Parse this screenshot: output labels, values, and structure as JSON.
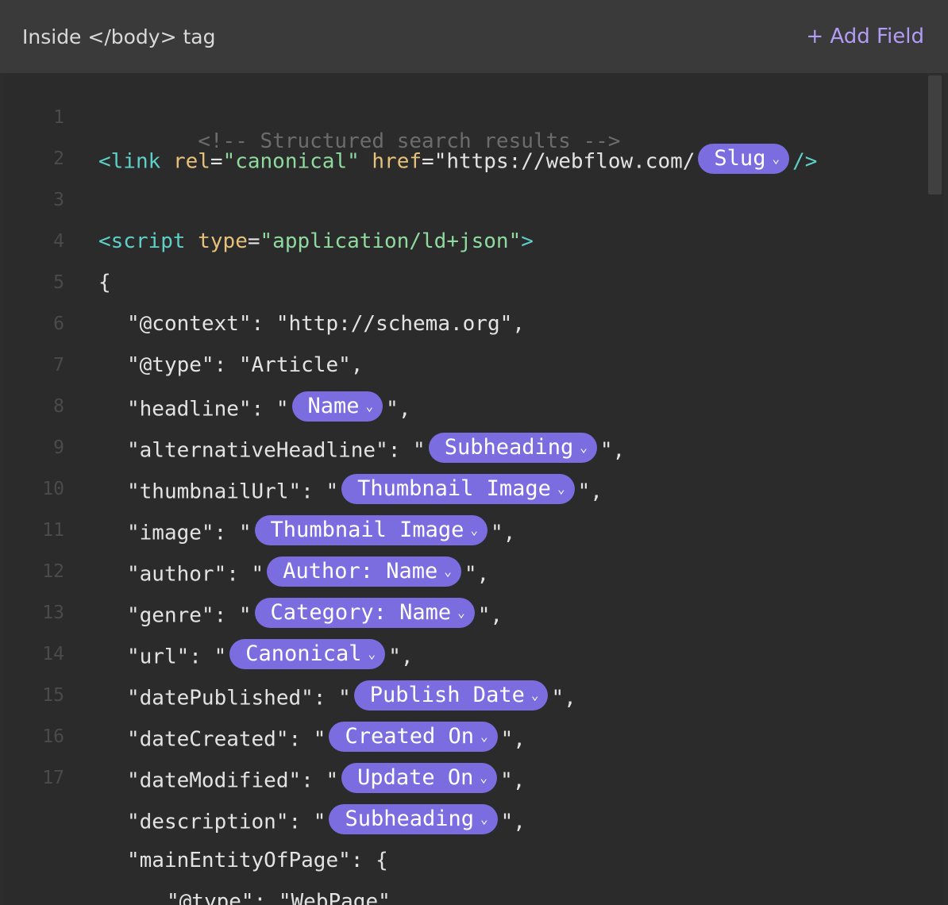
{
  "header": {
    "title": "Inside </body> tag",
    "add_field_label": "+ Add Field"
  },
  "line_numbers": [
    "1",
    "2",
    "3",
    "4",
    "5",
    "6",
    "7",
    "8",
    "9",
    "10",
    "11",
    "12",
    "13",
    "14",
    "15",
    "16",
    "17"
  ],
  "code": {
    "l1": "<!-- Structured search results -->",
    "l2": {
      "open": "<link",
      "attr1": "rel",
      "eq1": "=",
      "val1": "\"canonical\"",
      "attr2": "href",
      "eq2": "=",
      "val2": "\"https://webflow.com/",
      "pill": "Slug",
      "close": "/>"
    },
    "l4": {
      "open": "<script",
      "attr": "type",
      "eq": "=",
      "val": "\"application/ld+json\"",
      "close": ">"
    },
    "l5": "{",
    "l6": "\"@context\": \"http://schema.org\",",
    "l7": "\"@type\": \"Article\",",
    "l8": {
      "key": "\"headline\": \"",
      "pill": "Name",
      "tail": "\","
    },
    "l9": {
      "key": "\"alternativeHeadline\": \"",
      "pill": "Subheading",
      "tail": "\","
    },
    "l10": {
      "key": "\"thumbnailUrl\": \"",
      "pill": "Thumbnail Image",
      "tail": "\","
    },
    "l11": {
      "key": "\"image\": \"",
      "pill": "Thumbnail Image",
      "tail": "\","
    },
    "l12": {
      "key": "\"author\": \"",
      "pill": "Author: Name",
      "tail": "\","
    },
    "l13": {
      "key": "\"genre\": \"",
      "pill": "Category: Name",
      "tail": "\","
    },
    "l14": {
      "key": "\"url\": \"",
      "pill": "Canonical",
      "tail": "\","
    },
    "l15": {
      "key": "\"datePublished\": \"",
      "pill": "Publish Date",
      "tail": "\","
    },
    "l16": {
      "key": "\"dateCreated\": \"",
      "pill": "Created On",
      "tail": "\","
    },
    "l17": {
      "key": "\"dateModified\": \"",
      "pill": "Update On",
      "tail": "\","
    },
    "l18": {
      "key": "\"description\": \"",
      "pill": "Subheading",
      "tail": "\","
    },
    "l19": "\"mainEntityOfPage\": {",
    "l20": "\"@type\": \"WebPage\","
  },
  "chevron_glyph": "⌄"
}
